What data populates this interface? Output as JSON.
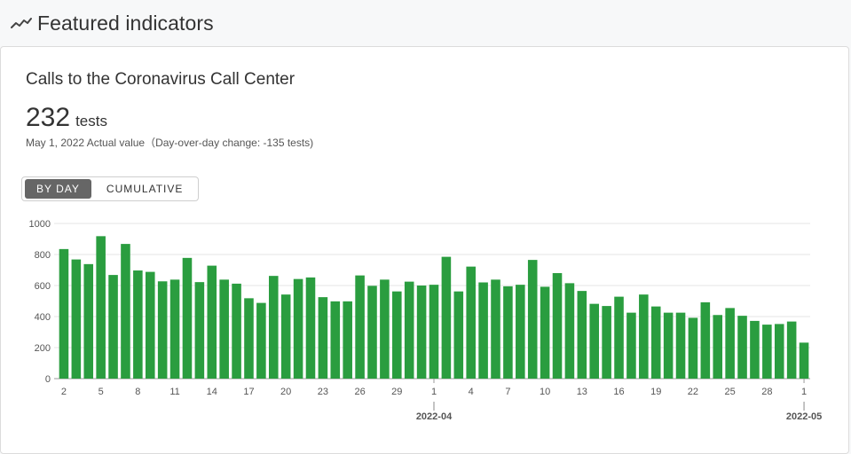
{
  "header": {
    "title": "Featured indicators",
    "icon": "trend-line-icon"
  },
  "card": {
    "title": "Calls to the Coronavirus Call Center",
    "value": "232",
    "unit": "tests",
    "note": "May 1, 2022 Actual value（Day-over-day change: -135 tests)"
  },
  "toggle": {
    "by_day": "BY DAY",
    "cumulative": "CUMULATIVE",
    "selected": "BY DAY"
  },
  "colors": {
    "bar": "#2a9d3f",
    "toggle_active": "#666666"
  },
  "chart_data": {
    "type": "bar",
    "ylim": [
      0,
      1000
    ],
    "yticks": [
      "0",
      "200",
      "400",
      "600",
      "800",
      "1000"
    ],
    "x": [
      "2022-03-02",
      "2022-03-03",
      "2022-03-04",
      "2022-03-05",
      "2022-03-06",
      "2022-03-07",
      "2022-03-08",
      "2022-03-09",
      "2022-03-10",
      "2022-03-11",
      "2022-03-12",
      "2022-03-13",
      "2022-03-14",
      "2022-03-15",
      "2022-03-16",
      "2022-03-17",
      "2022-03-18",
      "2022-03-19",
      "2022-03-20",
      "2022-03-21",
      "2022-03-22",
      "2022-03-23",
      "2022-03-24",
      "2022-03-25",
      "2022-03-26",
      "2022-03-27",
      "2022-03-28",
      "2022-03-29",
      "2022-03-30",
      "2022-03-31",
      "2022-04-01",
      "2022-04-02",
      "2022-04-03",
      "2022-04-04",
      "2022-04-05",
      "2022-04-06",
      "2022-04-07",
      "2022-04-08",
      "2022-04-09",
      "2022-04-10",
      "2022-04-11",
      "2022-04-12",
      "2022-04-13",
      "2022-04-14",
      "2022-04-15",
      "2022-04-16",
      "2022-04-17",
      "2022-04-18",
      "2022-04-19",
      "2022-04-20",
      "2022-04-21",
      "2022-04-22",
      "2022-04-23",
      "2022-04-24",
      "2022-04-25",
      "2022-04-26",
      "2022-04-27",
      "2022-04-28",
      "2022-04-29",
      "2022-04-30",
      "2022-05-01"
    ],
    "values": [
      835,
      768,
      738,
      918,
      668,
      868,
      697,
      688,
      627,
      638,
      778,
      622,
      728,
      638,
      612,
      518,
      488,
      662,
      542,
      642,
      652,
      525,
      498,
      498,
      665,
      598,
      638,
      562,
      625,
      600,
      605,
      785,
      562,
      722,
      620,
      638,
      595,
      605,
      765,
      592,
      680,
      615,
      565,
      482,
      468,
      528,
      425,
      542,
      465,
      425,
      425,
      392,
      492,
      410,
      455,
      405,
      372,
      348,
      352,
      368,
      232
    ],
    "tick_labels": [
      {
        "i": 0,
        "label": "2"
      },
      {
        "i": 3,
        "label": "5"
      },
      {
        "i": 6,
        "label": "8"
      },
      {
        "i": 9,
        "label": "11"
      },
      {
        "i": 12,
        "label": "14"
      },
      {
        "i": 15,
        "label": "17"
      },
      {
        "i": 18,
        "label": "20"
      },
      {
        "i": 21,
        "label": "23"
      },
      {
        "i": 24,
        "label": "26"
      },
      {
        "i": 27,
        "label": "29"
      },
      {
        "i": 30,
        "label": "1"
      },
      {
        "i": 33,
        "label": "4"
      },
      {
        "i": 36,
        "label": "7"
      },
      {
        "i": 39,
        "label": "10"
      },
      {
        "i": 42,
        "label": "13"
      },
      {
        "i": 45,
        "label": "16"
      },
      {
        "i": 48,
        "label": "19"
      },
      {
        "i": 51,
        "label": "22"
      },
      {
        "i": 54,
        "label": "25"
      },
      {
        "i": 57,
        "label": "28"
      },
      {
        "i": 60,
        "label": "1"
      }
    ],
    "month_labels": [
      {
        "i": 30,
        "label": "2022-04"
      },
      {
        "i": 60,
        "label": "2022-05"
      }
    ],
    "grid": true,
    "legend": "none"
  }
}
